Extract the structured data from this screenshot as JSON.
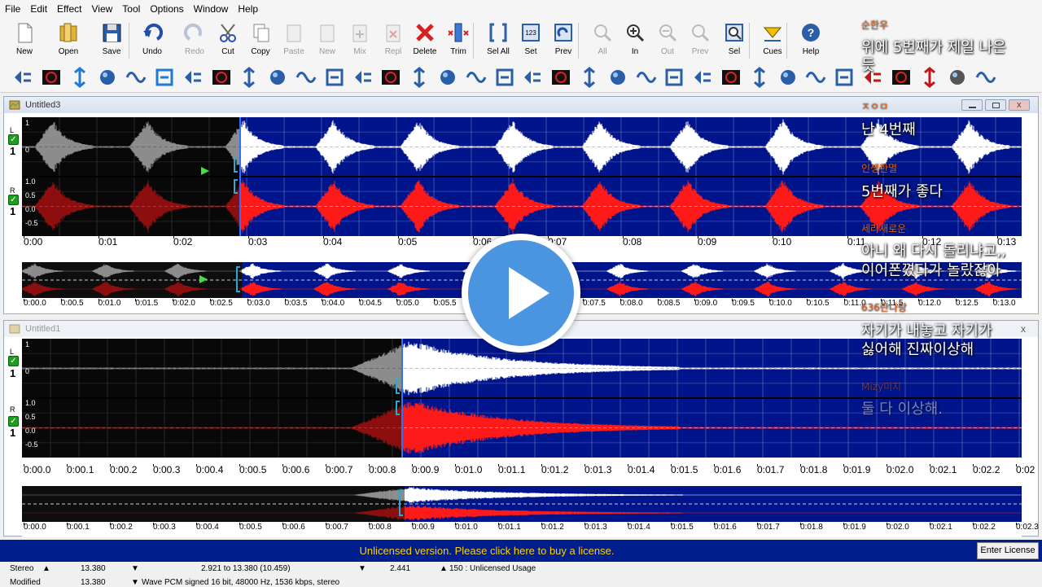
{
  "menu": [
    "File",
    "Edit",
    "Effect",
    "View",
    "Tool",
    "Options",
    "Window",
    "Help"
  ],
  "toolbar": [
    {
      "label": "New",
      "icon": "new-file-icon",
      "enabled": true
    },
    {
      "label": "Open",
      "icon": "open-folder-icon",
      "enabled": true
    },
    {
      "label": "Save",
      "icon": "save-disk-icon",
      "enabled": true
    },
    {
      "label": "Undo",
      "icon": "undo-icon",
      "enabled": true
    },
    {
      "label": "Redo",
      "icon": "redo-icon",
      "enabled": false
    },
    {
      "label": "Cut",
      "icon": "cut-icon",
      "enabled": true
    },
    {
      "label": "Copy",
      "icon": "copy-icon",
      "enabled": true
    },
    {
      "label": "Paste",
      "icon": "paste-icon",
      "enabled": false
    },
    {
      "label": "New",
      "icon": "paste-new-icon",
      "enabled": false
    },
    {
      "label": "Mix",
      "icon": "mix-icon",
      "enabled": false
    },
    {
      "label": "Repl",
      "icon": "replace-icon",
      "enabled": false
    },
    {
      "label": "Delete",
      "icon": "delete-icon",
      "enabled": true
    },
    {
      "label": "Trim",
      "icon": "trim-icon",
      "enabled": true
    },
    {
      "label": "Sel All",
      "icon": "select-all-icon",
      "enabled": true
    },
    {
      "label": "Set",
      "icon": "set-selection-icon",
      "enabled": true
    },
    {
      "label": "Prev",
      "icon": "preview-selection-icon",
      "enabled": true
    },
    {
      "label": "All",
      "icon": "zoom-all-icon",
      "enabled": false
    },
    {
      "label": "In",
      "icon": "zoom-in-icon",
      "enabled": true
    },
    {
      "label": "Out",
      "icon": "zoom-out-icon",
      "enabled": false
    },
    {
      "label": "Prev",
      "icon": "zoom-previous-icon",
      "enabled": false
    },
    {
      "label": "Sel",
      "icon": "zoom-selection-icon",
      "enabled": true
    },
    {
      "label": "Cues",
      "icon": "cues-icon",
      "enabled": true
    },
    {
      "label": "Help",
      "icon": "help-icon",
      "enabled": true
    }
  ],
  "windows": [
    {
      "title": "Untitled3",
      "ruler_ticks": [
        "0:00",
        "0:01",
        "0:02",
        "0:03",
        "0:04",
        "0:05",
        "0:06",
        "0:07",
        "0:08",
        "0:09",
        "0:10",
        "0:11",
        "0:12",
        "0:13"
      ],
      "overview_ticks": [
        "0:00.0",
        "0:00.5",
        "0:01.0",
        "0:01.5",
        "0:02.0",
        "0:02.5",
        "0:03.0",
        "0:03.5",
        "0:04.0",
        "0:04.5",
        "0:05.0",
        "0:05.5",
        "0:06.0",
        "0:06.5",
        "0:07.0",
        "0:07.5",
        "0:08.0",
        "0:08.5",
        "0:09.0",
        "0:09.5",
        "0:10.0",
        "0:10.5",
        "0:11.0",
        "0:11.5",
        "0:12.0",
        "0:12.5",
        "0:13.0"
      ],
      "left_ticks": [
        "1",
        "0"
      ],
      "right_ticks": [
        "1.0",
        "0.5",
        "0.0",
        "-0.5"
      ],
      "channel_labels": {
        "left": "L",
        "right": "R",
        "left_num": "1",
        "right_num": "1"
      }
    },
    {
      "title": "Untitled1",
      "ruler_ticks": [
        "0:00.0",
        "0:00.1",
        "0:00.2",
        "0:00.3",
        "0:00.4",
        "0:00.5",
        "0:00.6",
        "0:00.7",
        "0:00.8",
        "0:00.9",
        "0:01.0",
        "0:01.1",
        "0:01.2",
        "0:01.3",
        "0:01.4",
        "0:01.5",
        "0:01.6",
        "0:01.7",
        "0:01.8",
        "0:01.9",
        "0:02.0",
        "0:02.1",
        "0:02.2",
        "0:02"
      ],
      "overview_ticks": [
        "0:00.0",
        "0:00.1",
        "0:00.2",
        "0:00.3",
        "0:00.4",
        "0:00.5",
        "0:00.6",
        "0:00.7",
        "0:00.8",
        "0:00.9",
        "0:01.0",
        "0:01.1",
        "0:01.2",
        "0:01.3",
        "0:01.4",
        "0:01.5",
        "0:01.6",
        "0:01.7",
        "0:01.8",
        "0:01.9",
        "0:02.0",
        "0:02.1",
        "0:02.2",
        "0:02.3"
      ],
      "left_ticks": [
        "1",
        "0"
      ],
      "right_ticks": [
        "1.0",
        "0.5",
        "0.0",
        "-0.5"
      ],
      "channel_labels": {
        "left": "L",
        "right": "R",
        "left_num": "1",
        "right_num": "1"
      }
    }
  ],
  "license_bar": {
    "text": "Unlicensed version. Please click here to buy a license.",
    "button": "Enter License"
  },
  "status": {
    "row1": {
      "mode": "Stereo",
      "length": "13.380",
      "selection": "2.921 to 13.380 (10.459)",
      "cursor": "2.441",
      "usage": "150 : Unlicensed Usage"
    },
    "row2": {
      "state": "Modified",
      "length": "13.380",
      "format": "Wave PCM signed 16 bit, 48000 Hz, 1536 kbps, stereo"
    }
  },
  "chat": [
    {
      "name": "순한우",
      "msg_lines": [
        "위에 5번째가 제일 나은",
        "듯"
      ]
    },
    {
      "name": "ㅈㅇㅁ",
      "msg_lines": [
        "난 4번째"
      ]
    },
    {
      "name": "인생한멸",
      "msg_lines": [
        "5번째가 좋다"
      ]
    },
    {
      "name": "세라새로운",
      "msg_lines": [
        "아니 왜 다시 돌리냐고,,",
        "이어폰꼈다가 놀랐잖아"
      ]
    },
    {
      "name": "636란나랑",
      "msg_lines": [
        "자기가 내놓고 자기가",
        "싫어해 진짜이상해"
      ]
    },
    {
      "name": "Mizy미지",
      "msg_lines": [
        "둘 다 이상해."
      ]
    }
  ],
  "colors": {
    "waveform_bg": "#00158c",
    "left_channel": "#ffffff",
    "right_channel": "#ff1a1a",
    "unselected_bg": "#101010",
    "license_bar": "#001e8c",
    "license_text": "#ffd000",
    "accent": "#4a94e0"
  }
}
